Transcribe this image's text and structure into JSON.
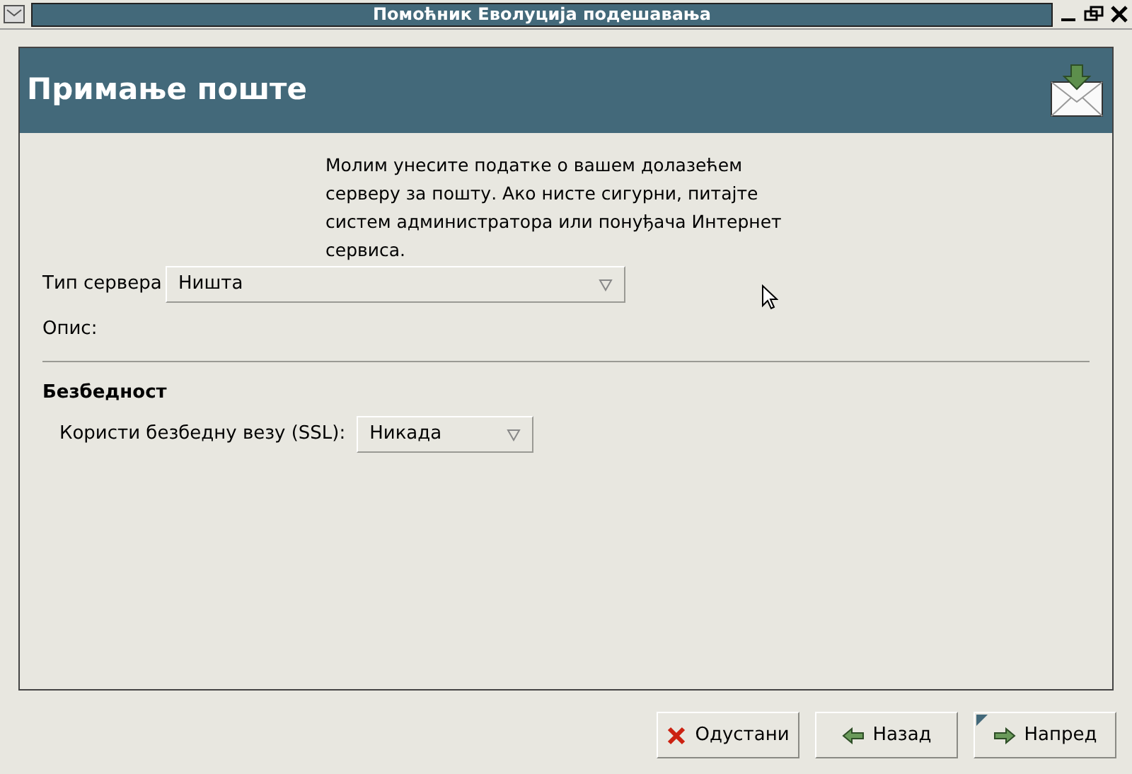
{
  "window": {
    "title": "Помоћник Еволуција подешавања"
  },
  "header": {
    "title": "Примање поште"
  },
  "intro": "Молим унесите податке о вашем долазећем серверу за пошту. Ако нисте сигурни, питајте систем администратора или понуђача Интернет сервиса.",
  "server_type": {
    "label": "Тип сервера",
    "value": "Ништа"
  },
  "description": {
    "label": "Опис:"
  },
  "security": {
    "heading": "Безбедност",
    "ssl_label": "Користи безбедну везу (SSL):",
    "ssl_value": "Никада"
  },
  "buttons": [
    {
      "kind": "cancel",
      "label": "Одустани",
      "default": false
    },
    {
      "kind": "back",
      "label": "Назад",
      "default": false
    },
    {
      "kind": "forward",
      "label": "Напред",
      "default": true
    }
  ]
}
